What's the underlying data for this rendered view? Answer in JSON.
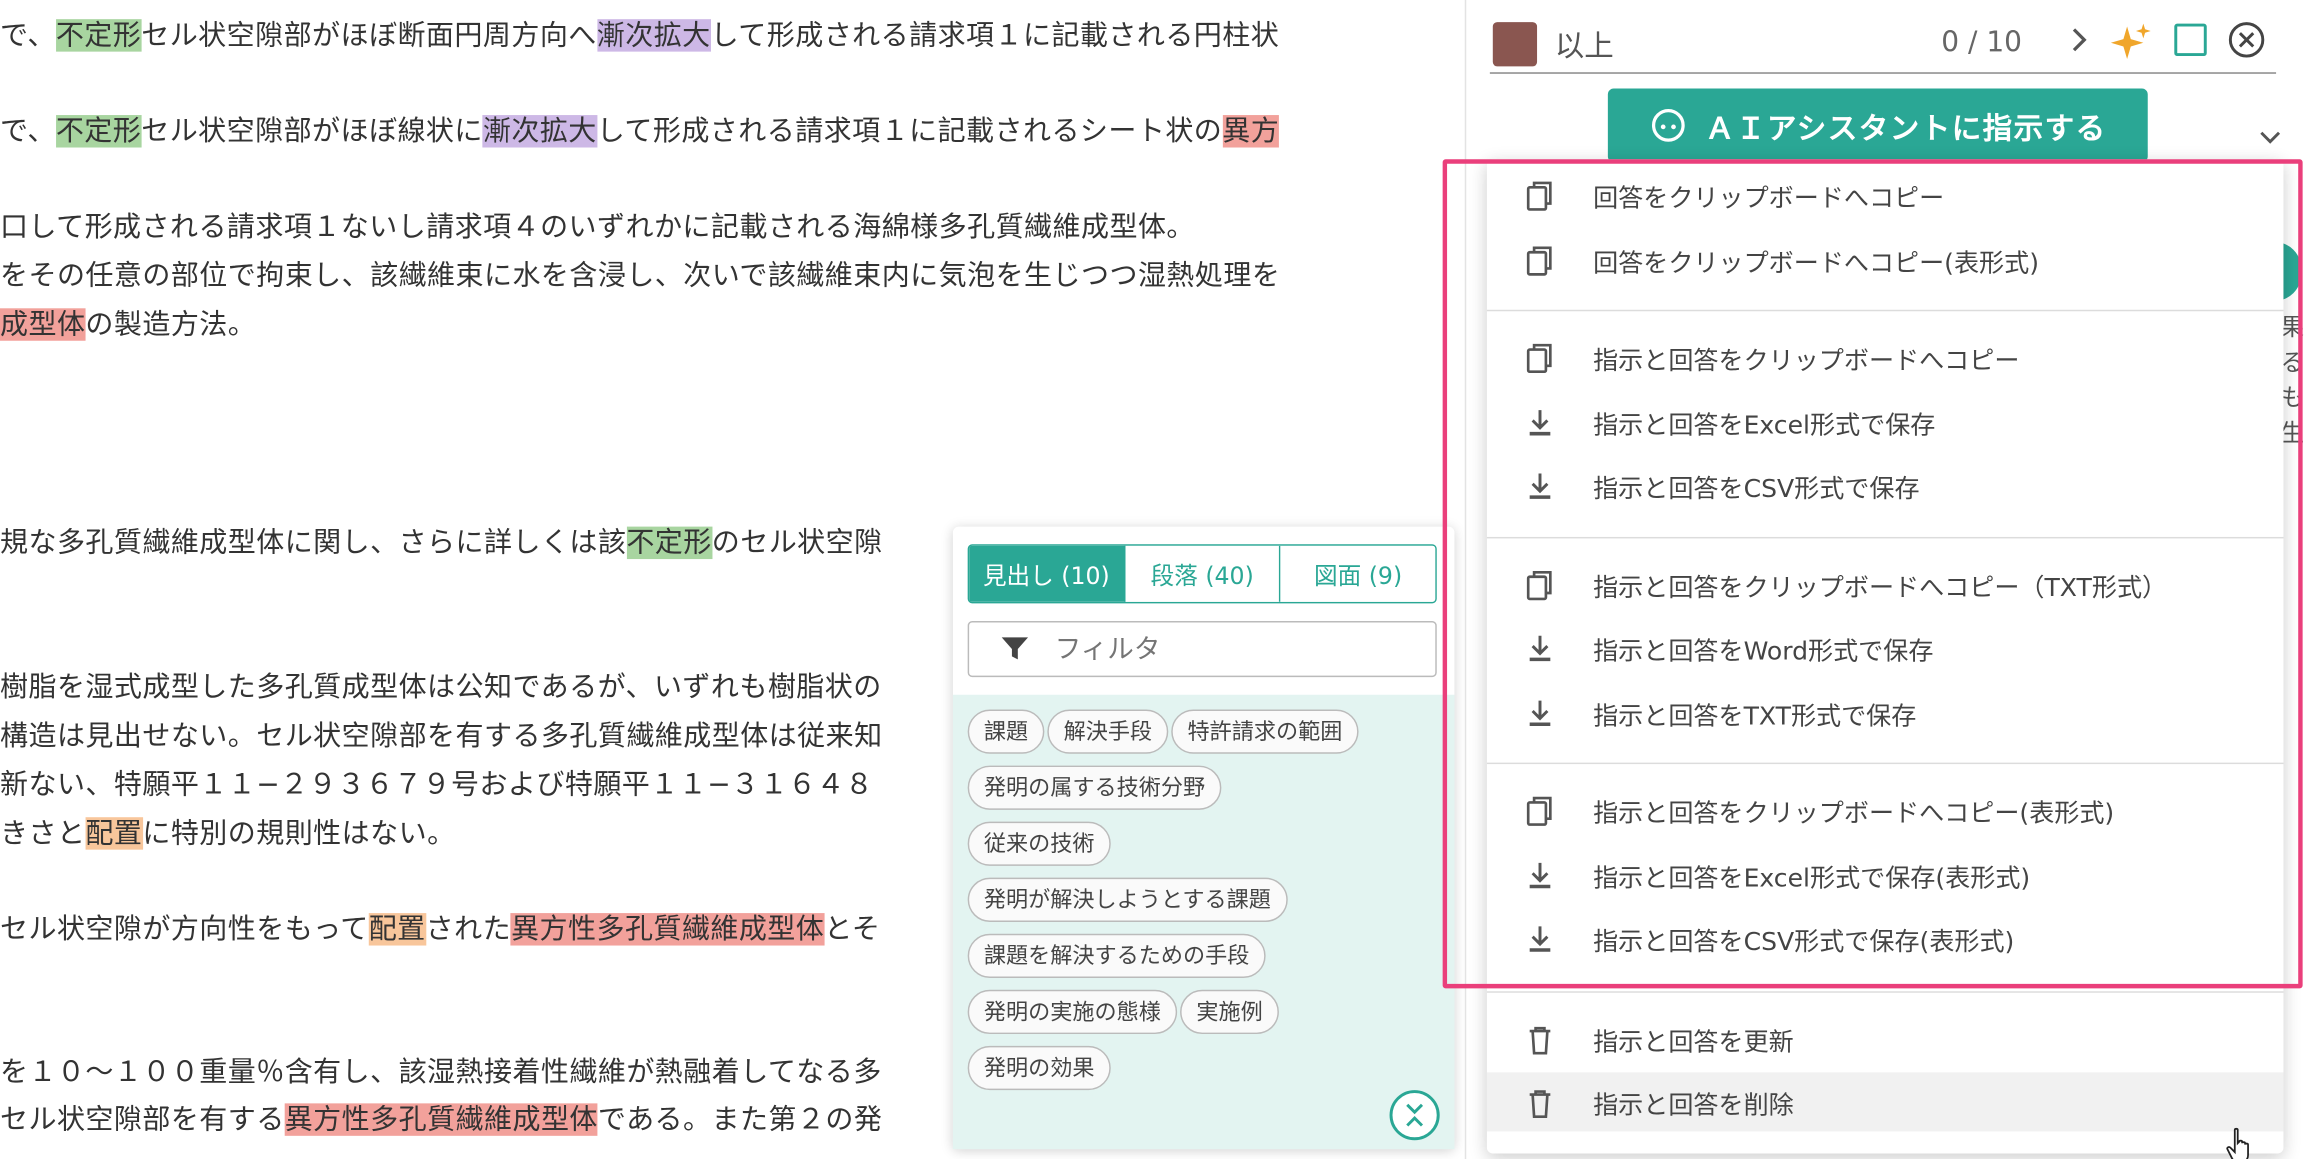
{
  "document": {
    "lines": [
      {
        "t": [
          [
            "で、",
            ""
          ],
          [
            "不定形",
            "green"
          ],
          [
            "セル状空隙部がほぼ断面円周方向へ",
            ""
          ],
          [
            "漸次拡大",
            "purple"
          ],
          [
            "して形成される請求項１に記載される円柱状",
            ""
          ]
        ]
      },
      {
        "t": [
          [
            "で、",
            ""
          ],
          [
            "不定形",
            "green"
          ],
          [
            "セル状空隙部がほぼ線状に",
            ""
          ],
          [
            "漸次拡大",
            "purple"
          ],
          [
            "して形成される請求項１に記載されるシート状の",
            ""
          ],
          [
            "異方",
            "red"
          ]
        ]
      },
      {
        "t": [
          [
            "口して形成される請求項１ないし請求項４のいずれかに記載される海綿様多孔質繊維成型体。",
            ""
          ]
        ]
      },
      {
        "t": [
          [
            "をその任意の部位で拘束し、該繊維束に水を含浸し、次いで該繊維束内に気泡を生じつつ湿熱処理を",
            ""
          ]
        ]
      },
      {
        "t": [
          [
            "成型体",
            "red"
          ],
          [
            "の製造方法。",
            ""
          ]
        ]
      },
      {
        "t": [
          [
            "規な多孔質繊維成型体に関し、さらに詳しくは該",
            ""
          ],
          [
            "不定形",
            "green"
          ],
          [
            "のセル状空隙",
            ""
          ]
        ]
      },
      {
        "t": [
          [
            "樹脂を湿式成型した多孔質成型体は公知であるが、いずれも樹脂状の",
            ""
          ]
        ]
      },
      {
        "t": [
          [
            "構造は見出せない。セル状空隙部を有する多孔質繊維成型体は従来知",
            ""
          ]
        ]
      },
      {
        "t": [
          [
            "新ない、特願平１１−２９３６７９号および特願平１１−３１６４８",
            ""
          ]
        ]
      },
      {
        "t": [
          [
            "きさと",
            ""
          ],
          [
            "配置",
            "orange"
          ],
          [
            "に特別の規則性はない。",
            ""
          ]
        ]
      },
      {
        "t": [
          [
            "セル状空隙が方向性をもって",
            ""
          ],
          [
            "配置",
            "orange"
          ],
          [
            "された",
            ""
          ],
          [
            "異方性多孔質繊維成型体",
            "red"
          ],
          [
            "とそ",
            ""
          ]
        ]
      },
      {
        "t": [
          [
            "を１０〜１００重量％含有し、該湿熱接着性繊維が熱融着してなる多",
            ""
          ]
        ]
      },
      {
        "t": [
          [
            "セル状空隙部を有する",
            ""
          ],
          [
            "異方性多孔質繊維成型体",
            "red"
          ],
          [
            "である。また第２の発",
            ""
          ]
        ]
      }
    ]
  },
  "outline": {
    "tabs": [
      "見出し (10)",
      "段落 (40)",
      "図面 (9)"
    ],
    "filter_placeholder": "フィルタ",
    "chip_rows": [
      [
        "課題",
        "解決手段",
        "特許請求の範囲"
      ],
      [
        "発明の属する技術分野"
      ],
      [
        "従来の技術"
      ],
      [
        "発明が解決しようとする課題"
      ],
      [
        "課題を解決するための手段"
      ],
      [
        "発明の実施の態様",
        "実施例"
      ],
      [
        "発明の効果"
      ]
    ]
  },
  "panel": {
    "condition": "以上",
    "counter": "0 / 10",
    "ai_button": "ＡＩアシスタントに指示する",
    "ghost_chars": "果るも生"
  },
  "menu": {
    "groups": [
      [
        {
          "icon": "copy-icon",
          "label": "回答をクリップボードへコピー"
        },
        {
          "icon": "copy-icon",
          "label": "回答をクリップボードへコピー(表形式)"
        }
      ],
      [
        {
          "icon": "copy-icon",
          "label": "指示と回答をクリップボードへコピー"
        },
        {
          "icon": "download-icon",
          "label": "指示と回答をExcel形式で保存"
        },
        {
          "icon": "download-icon",
          "label": "指示と回答をCSV形式で保存"
        }
      ],
      [
        {
          "icon": "copy-icon",
          "label": "指示と回答をクリップボードへコピー（TXT形式）"
        },
        {
          "icon": "download-icon",
          "label": "指示と回答をWord形式で保存"
        },
        {
          "icon": "download-icon",
          "label": "指示と回答をTXT形式で保存"
        }
      ],
      [
        {
          "icon": "copy-icon",
          "label": "指示と回答をクリップボードへコピー(表形式)"
        },
        {
          "icon": "download-icon",
          "label": "指示と回答をExcel形式で保存(表形式)"
        },
        {
          "icon": "download-icon",
          "label": "指示と回答をCSV形式で保存(表形式)"
        }
      ],
      [
        {
          "icon": "trash-icon",
          "label": "指示と回答を更新"
        },
        {
          "icon": "trash-icon",
          "label": "指示と回答を削除"
        }
      ]
    ]
  },
  "colors": {
    "accent": "#2aa795",
    "highlight_box": "#ea3f7b",
    "swatch": "#8a5650",
    "hl_green": "#a8d5a0",
    "hl_purple": "#cdb8e6",
    "hl_red": "#f2a19b",
    "hl_orange": "#f8c69b"
  }
}
